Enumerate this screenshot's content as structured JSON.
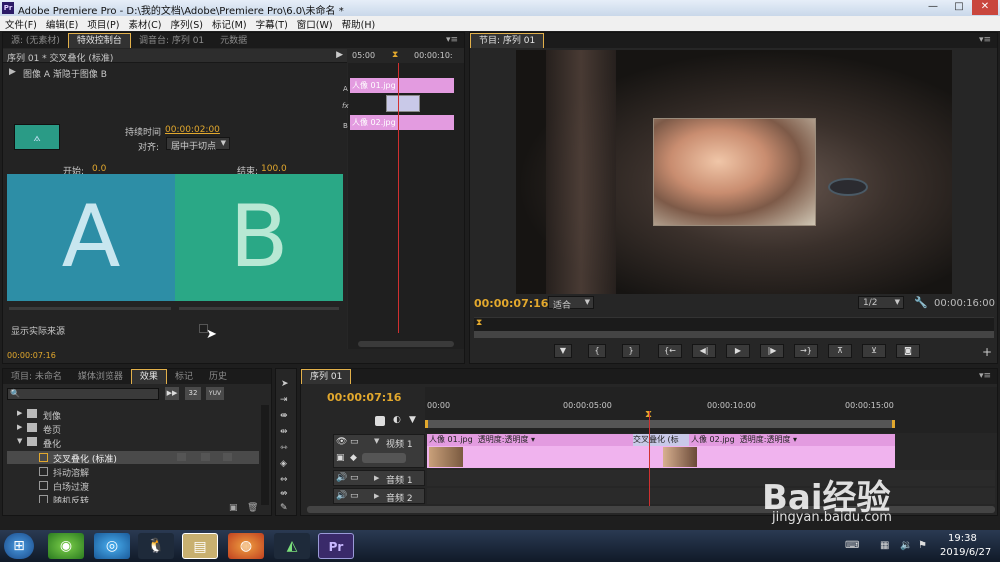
{
  "window": {
    "title": "Adobe Premiere Pro - D:\\我的文档\\Adobe\\Premiere Pro\\6.0\\未命名 *",
    "app_icon": "Pr"
  },
  "menu": [
    "文件(F)",
    "编辑(E)",
    "项目(P)",
    "素材(C)",
    "序列(S)",
    "标记(M)",
    "字幕(T)",
    "窗口(W)",
    "帮助(H)"
  ],
  "source_panel": {
    "tabs": [
      "源: (无素材)",
      "特效控制台",
      "调音台: 序列 01",
      "元数据"
    ],
    "header": "序列 01 * 交叉叠化 (标准)",
    "subheader": "图像 A 渐隐于图像 B",
    "duration_label": "持续时间",
    "duration_value": "00:00:02:00",
    "align_label": "对齐:",
    "align_value": "居中于切点",
    "start_label": "开始:",
    "start_value": "0.0",
    "end_label": "结束:",
    "end_value": "100.0",
    "letter_a": "A",
    "letter_b": "B",
    "show_source": "显示实际来源",
    "timecode": "00:00:07:16",
    "mini_ruler": [
      "05:00",
      "00:00:10:"
    ],
    "track_a": "A",
    "track_fx": "fx",
    "track_b": "B",
    "clip1": "人像 01.jpg",
    "clip2": "人像 02.jpg"
  },
  "program_panel": {
    "tab": "节目: 序列 01",
    "timecode": "00:00:07:16",
    "fit": "适合",
    "ratio": "1/2",
    "duration": "00:00:16:00"
  },
  "project_panel": {
    "tabs": [
      "项目: 未命名",
      "媒体浏览器",
      "效果",
      "标记",
      "历史"
    ],
    "items": [
      {
        "label": "划像",
        "type": "folder"
      },
      {
        "label": "卷页",
        "type": "folder"
      },
      {
        "label": "叠化",
        "type": "folder-open"
      },
      {
        "label": "交叉叠化 (标准)",
        "type": "effect",
        "selected": true
      },
      {
        "label": "抖动溶解",
        "type": "effect"
      },
      {
        "label": "白场过渡",
        "type": "effect"
      },
      {
        "label": "随机反转",
        "type": "effect"
      }
    ],
    "badges": [
      "32",
      "YUV"
    ]
  },
  "timeline": {
    "tab": "序列 01",
    "timecode": "00:00:07:16",
    "ruler": [
      "00:00",
      "00:00:05:00",
      "00:00:10:00",
      "00:00:15:00"
    ],
    "tracks": [
      {
        "name": "视频 1",
        "type": "video"
      },
      {
        "name": "音频 1",
        "type": "audio"
      },
      {
        "name": "音频 2",
        "type": "audio"
      }
    ],
    "clip1_label": "人像 01.jpg",
    "clip1_fx": "透明度:透明度",
    "transition_label": "交叉叠化 (标",
    "clip2_label": "人像 02.jpg",
    "clip2_fx": "透明度:透明度"
  },
  "taskbar": {
    "time": "19:38",
    "date": "2019/6/27",
    "active": "Pr"
  },
  "watermark": {
    "brand": "Bai经验",
    "url": "jingyan.baidu.com"
  },
  "colors": {
    "accent": "#e2a82d",
    "pink_clip": "#e39be0",
    "teal_a": "#2d8ea6",
    "green_b": "#2aa886",
    "playhead": "#d03030"
  }
}
